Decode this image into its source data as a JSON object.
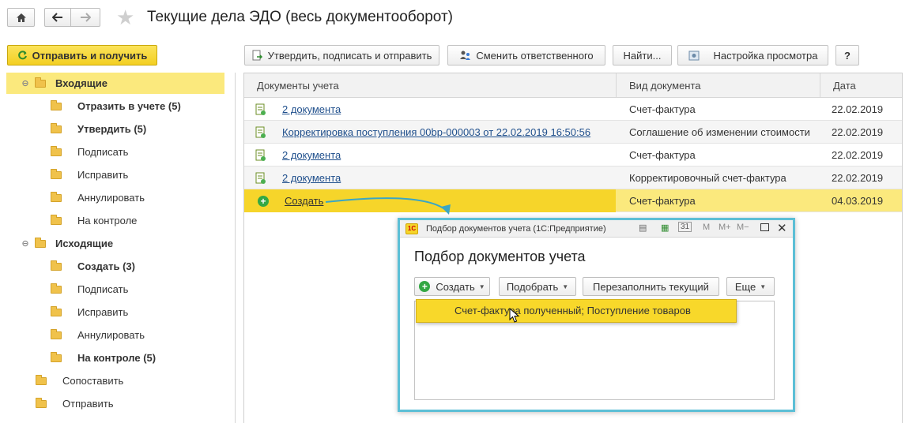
{
  "header": {
    "title": "Текущие дела ЭДО (весь документооборот)",
    "home_icon": "home-icon",
    "back_icon": "arrow-left-icon",
    "forward_icon": "arrow-right-icon",
    "favorite_icon": "star-icon"
  },
  "toolbar": {
    "send_receive": "Отправить и получить",
    "approve_sign_send": "Утвердить, подписать и отправить",
    "change_responsible": "Сменить ответственного",
    "find": "Найти...",
    "view_settings": "Настройка просмотра",
    "help": "?"
  },
  "sidebar": {
    "items": [
      {
        "label": "Входящие",
        "level": 0,
        "bold": true,
        "expanded": true,
        "selected": true
      },
      {
        "label": "Отразить в учете (5)",
        "level": 1,
        "bold": true
      },
      {
        "label": "Утвердить (5)",
        "level": 1,
        "bold": true
      },
      {
        "label": "Подписать",
        "level": 1,
        "bold": false
      },
      {
        "label": "Исправить",
        "level": 1,
        "bold": false
      },
      {
        "label": "Аннулировать",
        "level": 1,
        "bold": false
      },
      {
        "label": "На контроле",
        "level": 1,
        "bold": false
      },
      {
        "label": "Исходящие",
        "level": 0,
        "bold": true,
        "expanded": true
      },
      {
        "label": "Создать (3)",
        "level": 1,
        "bold": true
      },
      {
        "label": "Подписать",
        "level": 1,
        "bold": false
      },
      {
        "label": "Исправить",
        "level": 1,
        "bold": false
      },
      {
        "label": "Аннулировать",
        "level": 1,
        "bold": false
      },
      {
        "label": "На контроле (5)",
        "level": 1,
        "bold": true
      },
      {
        "label": "Сопоставить",
        "level": 0,
        "bold": false
      },
      {
        "label": "Отправить",
        "level": 0,
        "bold": false
      }
    ]
  },
  "table": {
    "columns": [
      "Документы учета",
      "Вид документа",
      "Дата"
    ],
    "rows": [
      {
        "doc": "2 документа",
        "type": "Счет-фактура",
        "date": "22.02.2019"
      },
      {
        "doc": "Корректировка поступления 00bp-000003 от 22.02.2019 16:50:56",
        "type": "Соглашение об изменении стоимости",
        "date": "22.02.2019"
      },
      {
        "doc": "2 документа",
        "type": "Счет-фактура",
        "date": "22.02.2019"
      },
      {
        "doc": "2 документа",
        "type": "Корректировочный счет-фактура",
        "date": "22.02.2019"
      },
      {
        "doc": "Создать",
        "type": "Счет-фактура",
        "date": "04.03.2019"
      }
    ]
  },
  "dialog": {
    "window_title": "Подбор документов учета  (1С:Предприятие)",
    "heading": "Подбор документов учета",
    "create_btn": "Создать",
    "pick_btn": "Подобрать",
    "refill_btn": "Перезаполнить текущий",
    "more_btn": "Еще",
    "dropdown_item": "Счет-фактура полученный;  Поступление товаров",
    "title_tools": [
      "M",
      "M+",
      "M−"
    ]
  },
  "colors": {
    "accent_yellow": "#f6d52a",
    "selection_yellow": "#fbe97d",
    "link_blue": "#1f4f8c",
    "dialog_border": "#5cbfd6",
    "green_plus": "#34a844"
  }
}
